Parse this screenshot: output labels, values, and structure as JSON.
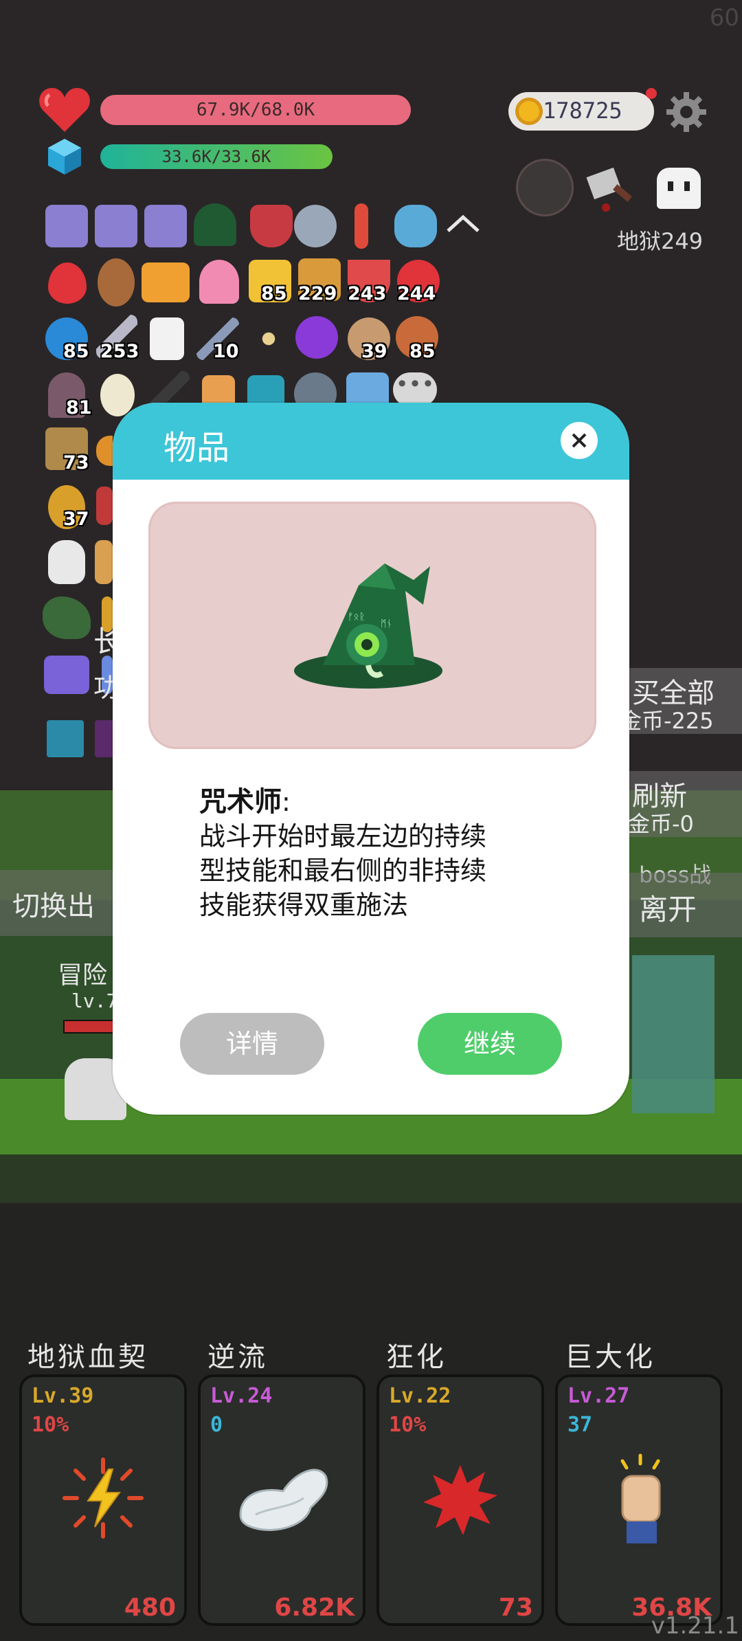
{
  "hud": {
    "hp_text": "67.9K/68.0K",
    "mana_text": "33.6K/33.6K",
    "hp_fraction": 0.998,
    "mana_fraction": 1.0,
    "gold": "178725",
    "hell_level": "地狱249",
    "fps_corner": "60"
  },
  "inventory_counts": {
    "row2": [
      "85",
      "229",
      "243",
      "244"
    ],
    "row3": [
      "85",
      "253",
      "10",
      "39",
      "85"
    ],
    "row4": [
      "81"
    ],
    "row5": [
      "73"
    ],
    "row6": [
      "37"
    ]
  },
  "background": {
    "buy_all": "买全部",
    "buy_all_cost": "金币-225",
    "refresh": "刷新",
    "refresh_cost": "金币-0",
    "boss": "boss战",
    "leave": "离开",
    "switch": "切换出",
    "adventure": "冒险",
    "level": "lv.7",
    "partial": "长",
    "partial2": "功"
  },
  "modal": {
    "title": "物品",
    "item_name": "咒术师",
    "item_colon": ":",
    "item_desc_lines": [
      "战斗开始时最左边的持续",
      "型技能和最右侧的非持续",
      "技能获得双重施法"
    ],
    "details_button": "详情",
    "continue_button": "继续"
  },
  "skills": [
    {
      "name": "地狱血契",
      "level": "Lv.39",
      "sub": "10%",
      "cost": "480",
      "level_color": "#d9a92a",
      "sub_color": "#e04646"
    },
    {
      "name": "逆流",
      "level": "Lv.24",
      "sub": "0",
      "cost": "6.82K",
      "level_color": "#c85bd6",
      "sub_color": "#3cb6d8"
    },
    {
      "name": "狂化",
      "level": "Lv.22",
      "sub": "10%",
      "cost": "73",
      "level_color": "#d9a92a",
      "sub_color": "#e04646"
    },
    {
      "name": "巨大化",
      "level": "Lv.27",
      "sub": "37",
      "cost": "36.8K",
      "level_color": "#c85bd6",
      "sub_color": "#3cb6d8"
    }
  ],
  "version": "v1.21.1"
}
